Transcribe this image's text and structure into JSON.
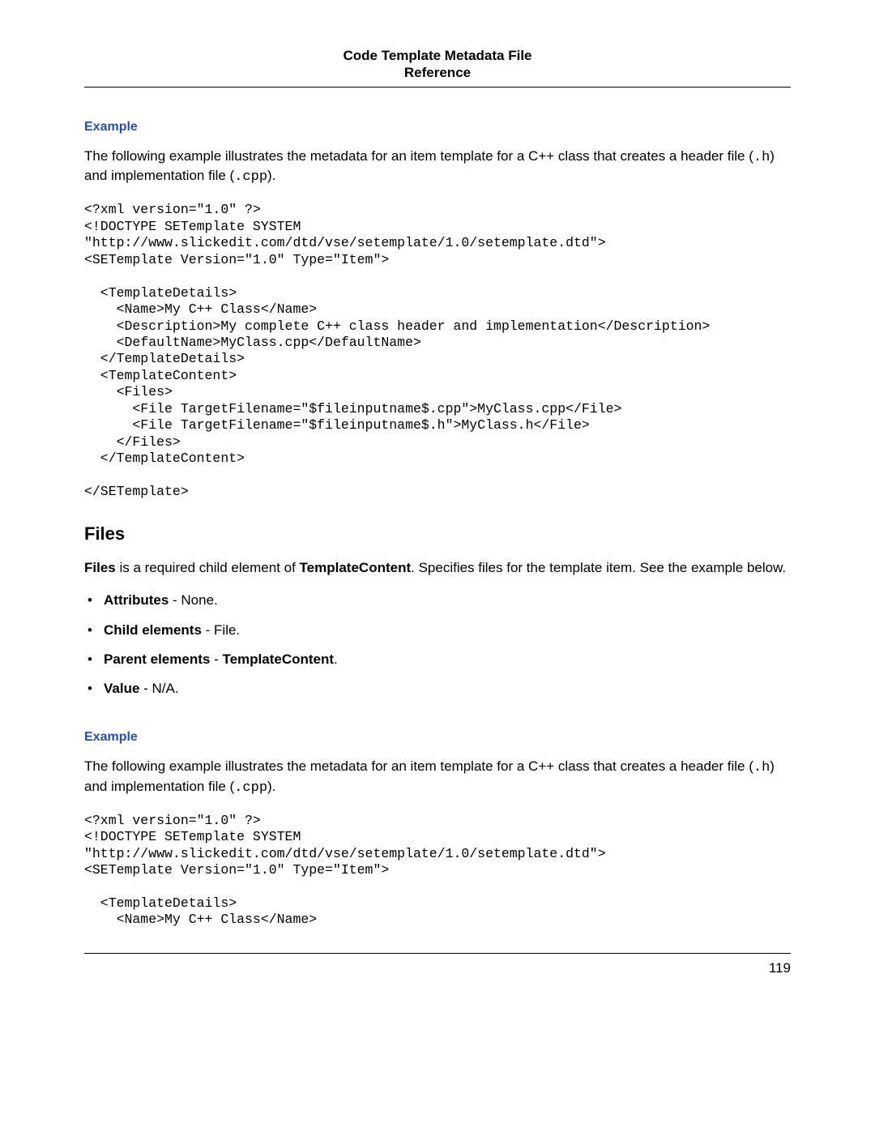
{
  "header": {
    "title_line1": "Code Template Metadata File",
    "title_line2": "Reference"
  },
  "example1": {
    "label": "Example",
    "intro_pre": "The following example illustrates the metadata for an item template for a C++ class that creates a header file (",
    "intro_code1": ".h",
    "intro_mid": ") and implementation file (",
    "intro_code2": ".cpp",
    "intro_post": ").",
    "code": "<?xml version=\"1.0\" ?>\n<!DOCTYPE SETemplate SYSTEM\n\"http://www.slickedit.com/dtd/vse/setemplate/1.0/setemplate.dtd\">\n<SETemplate Version=\"1.0\" Type=\"Item\">\n\n  <TemplateDetails>\n    <Name>My C++ Class</Name>\n    <Description>My complete C++ class header and implementation</Description>\n    <DefaultName>MyClass.cpp</DefaultName>\n  </TemplateDetails>\n  <TemplateContent>\n    <Files>\n      <File TargetFilename=\"$fileinputname$.cpp\">MyClass.cpp</File>\n      <File TargetFilename=\"$fileinputname$.h\">MyClass.h</File>\n    </Files>\n  </TemplateContent>\n\n</SETemplate>"
  },
  "files_section": {
    "heading": "Files",
    "desc_b1": "Files",
    "desc_t1": " is a required child element of ",
    "desc_b2": "TemplateContent",
    "desc_t2": ". Specifies files for the template item. See the example below.",
    "bullets": {
      "attr_label": "Attributes",
      "attr_text": " - None.",
      "child_label": "Child elements",
      "child_text": " - File.",
      "parent_label": "Parent elements",
      "parent_sep": " - ",
      "parent_val": "TemplateContent",
      "parent_post": ".",
      "value_label": "Value",
      "value_text": " - N/A."
    }
  },
  "example2": {
    "label": "Example",
    "intro_pre": "The following example illustrates the metadata for an item template for a C++ class that creates a header file (",
    "intro_code1": ".h",
    "intro_mid": ") and implementation file (",
    "intro_code2": ".cpp",
    "intro_post": ").",
    "code": "<?xml version=\"1.0\" ?>\n<!DOCTYPE SETemplate SYSTEM\n\"http://www.slickedit.com/dtd/vse/setemplate/1.0/setemplate.dtd\">\n<SETemplate Version=\"1.0\" Type=\"Item\">\n\n  <TemplateDetails>\n    <Name>My C++ Class</Name>"
  },
  "footer": {
    "page_number": "119"
  }
}
